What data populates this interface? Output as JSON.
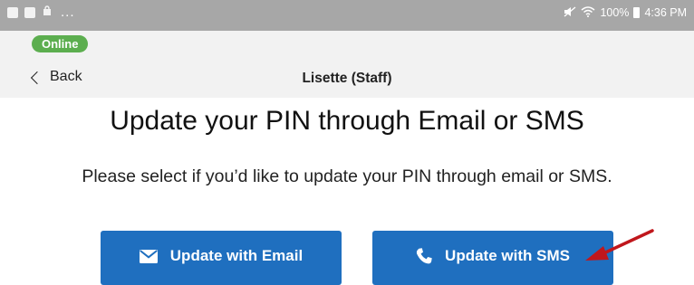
{
  "status_bar": {
    "left_icons": [
      "gallery-icon",
      "flipboard-icon",
      "bag-icon"
    ],
    "overflow": "...",
    "battery": "100%",
    "time": "4:36 PM"
  },
  "header": {
    "status_badge": "Online",
    "back_label": "Back",
    "title": "Lisette (Staff)"
  },
  "main": {
    "title": "Update your PIN through Email or SMS",
    "description": "Please select if you’d like to update your PIN through email or SMS.",
    "buttons": [
      {
        "icon": "envelope-icon",
        "label": "Update with Email"
      },
      {
        "icon": "phone-icon",
        "label": "Update with SMS"
      }
    ]
  },
  "colors": {
    "status_bar": "#a7a7a7",
    "header_bg": "#f2f2f2",
    "badge": "#5cae4f",
    "button": "#1f6fbf",
    "annotation_arrow": "#c0171c"
  }
}
